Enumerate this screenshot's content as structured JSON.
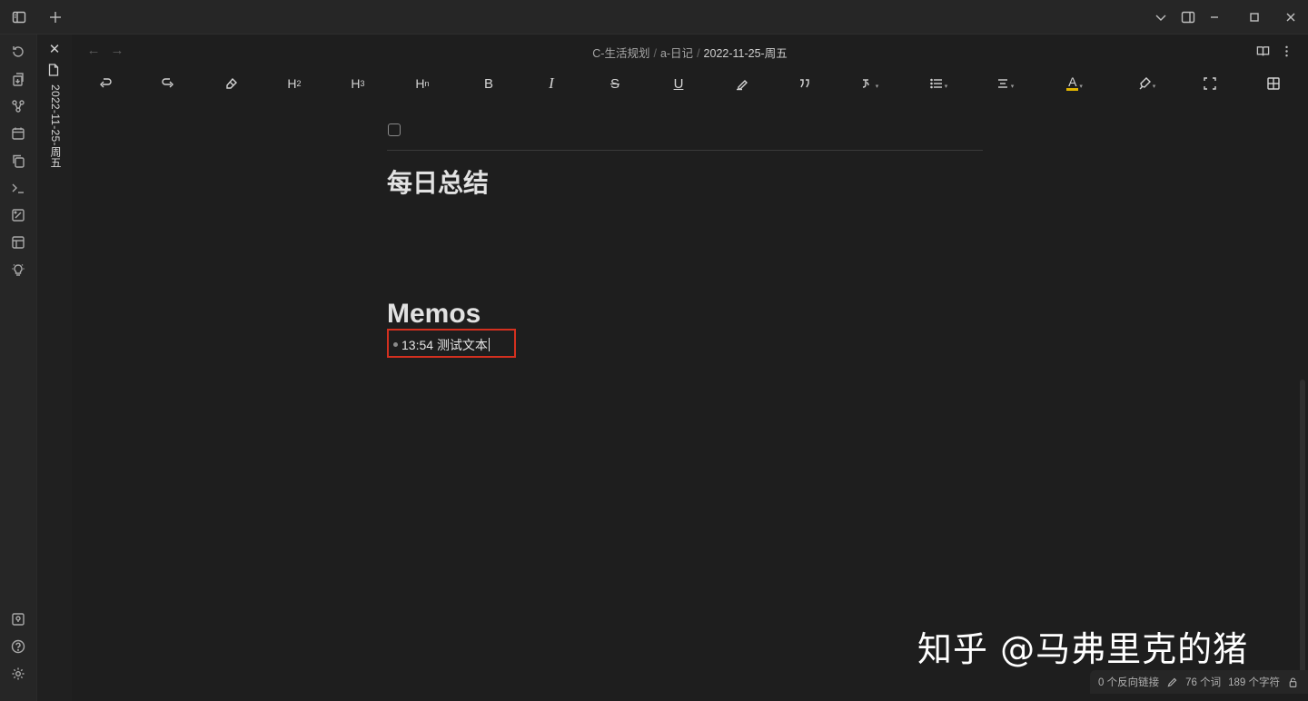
{
  "titlebar": {
    "buttons": [
      "sidebar-toggle-icon",
      "new-tab-icon",
      "chevron-down-icon",
      "right-sidebar-icon",
      "minimize-icon",
      "maximize-icon",
      "close-icon"
    ]
  },
  "ribbon": {
    "top_icons": [
      "sync-icon",
      "import-icon",
      "graph-icon",
      "calendar-icon",
      "copy-icon",
      "terminal-icon",
      "canvas-icon",
      "template-icon",
      "lightbulb-icon"
    ],
    "bottom_icons": [
      "vault-icon",
      "help-icon",
      "settings-icon"
    ]
  },
  "tab": {
    "close_symbol": "✕",
    "title": "2022-11-25-周五"
  },
  "viewhead": {
    "back": "←",
    "forward": "→",
    "breadcrumb": [
      "C-生活规划",
      "a-日记",
      "2022-11-25-周五"
    ],
    "separator": "/"
  },
  "toolbar": {
    "undo": "undo-icon",
    "redo": "redo-icon",
    "eraser": "eraser-icon",
    "h2": "H",
    "h2_sub": "2",
    "h3": "H",
    "h3_sub": "3",
    "hn": "H",
    "hn_sub": "n",
    "bold": "B",
    "italic": "I",
    "strike": "S",
    "underline": "U",
    "highlight": "highlight-pen-icon",
    "quote": "quote-icon",
    "code": "code-icon",
    "list": "list-icon",
    "align": "align-icon",
    "font_color": "A",
    "font_color_accent": "#e0b400",
    "brush": "brush-icon",
    "fullscreen": "fullscreen-icon",
    "table": "table-icon"
  },
  "content": {
    "heading_summary": "每日总结",
    "heading_memos": "Memos",
    "memo_time": "13:54",
    "memo_text": "测试文本",
    "highlight_color": "#d4301f"
  },
  "watermark": "知乎 @马弗里克的猪",
  "statusbar": {
    "backlinks": "0 个反向链接",
    "words": "76 个词",
    "chars": "189 个字符"
  }
}
